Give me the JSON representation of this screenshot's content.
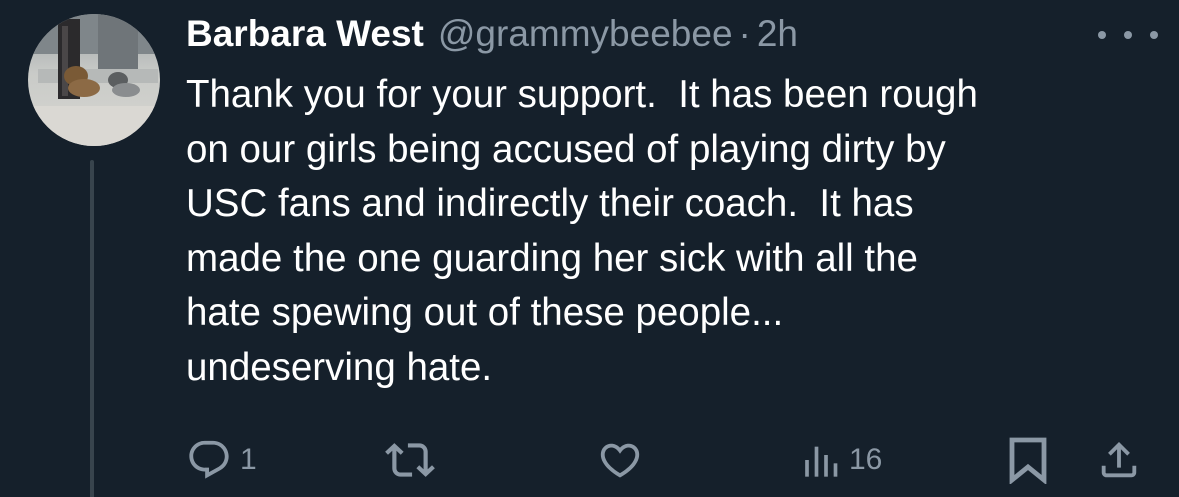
{
  "tweet": {
    "author": {
      "display_name": "Barbara West",
      "handle": "@grammybeebee",
      "separator": "·",
      "timestamp": "2h"
    },
    "text": "Thank you for your support.  It has been rough\non our girls being accused of playing dirty by\nUSC fans and indirectly their coach.  It has\nmade the one guarding her sick with all the\nhate spewing out of these people...\nundeserving hate.",
    "actions": {
      "reply": {
        "icon": "reply-icon",
        "count": "1"
      },
      "retweet": {
        "icon": "retweet-icon",
        "count": ""
      },
      "like": {
        "icon": "heart-icon",
        "count": ""
      },
      "views": {
        "icon": "views-icon",
        "count": "16"
      },
      "bookmark": {
        "icon": "bookmark-icon"
      },
      "share": {
        "icon": "share-icon"
      }
    },
    "more_icon": "more-options-icon"
  },
  "colors": {
    "background": "#15202b",
    "primary_text": "#ffffff",
    "secondary_text": "#8b98a5",
    "thread_line": "#38444d"
  }
}
